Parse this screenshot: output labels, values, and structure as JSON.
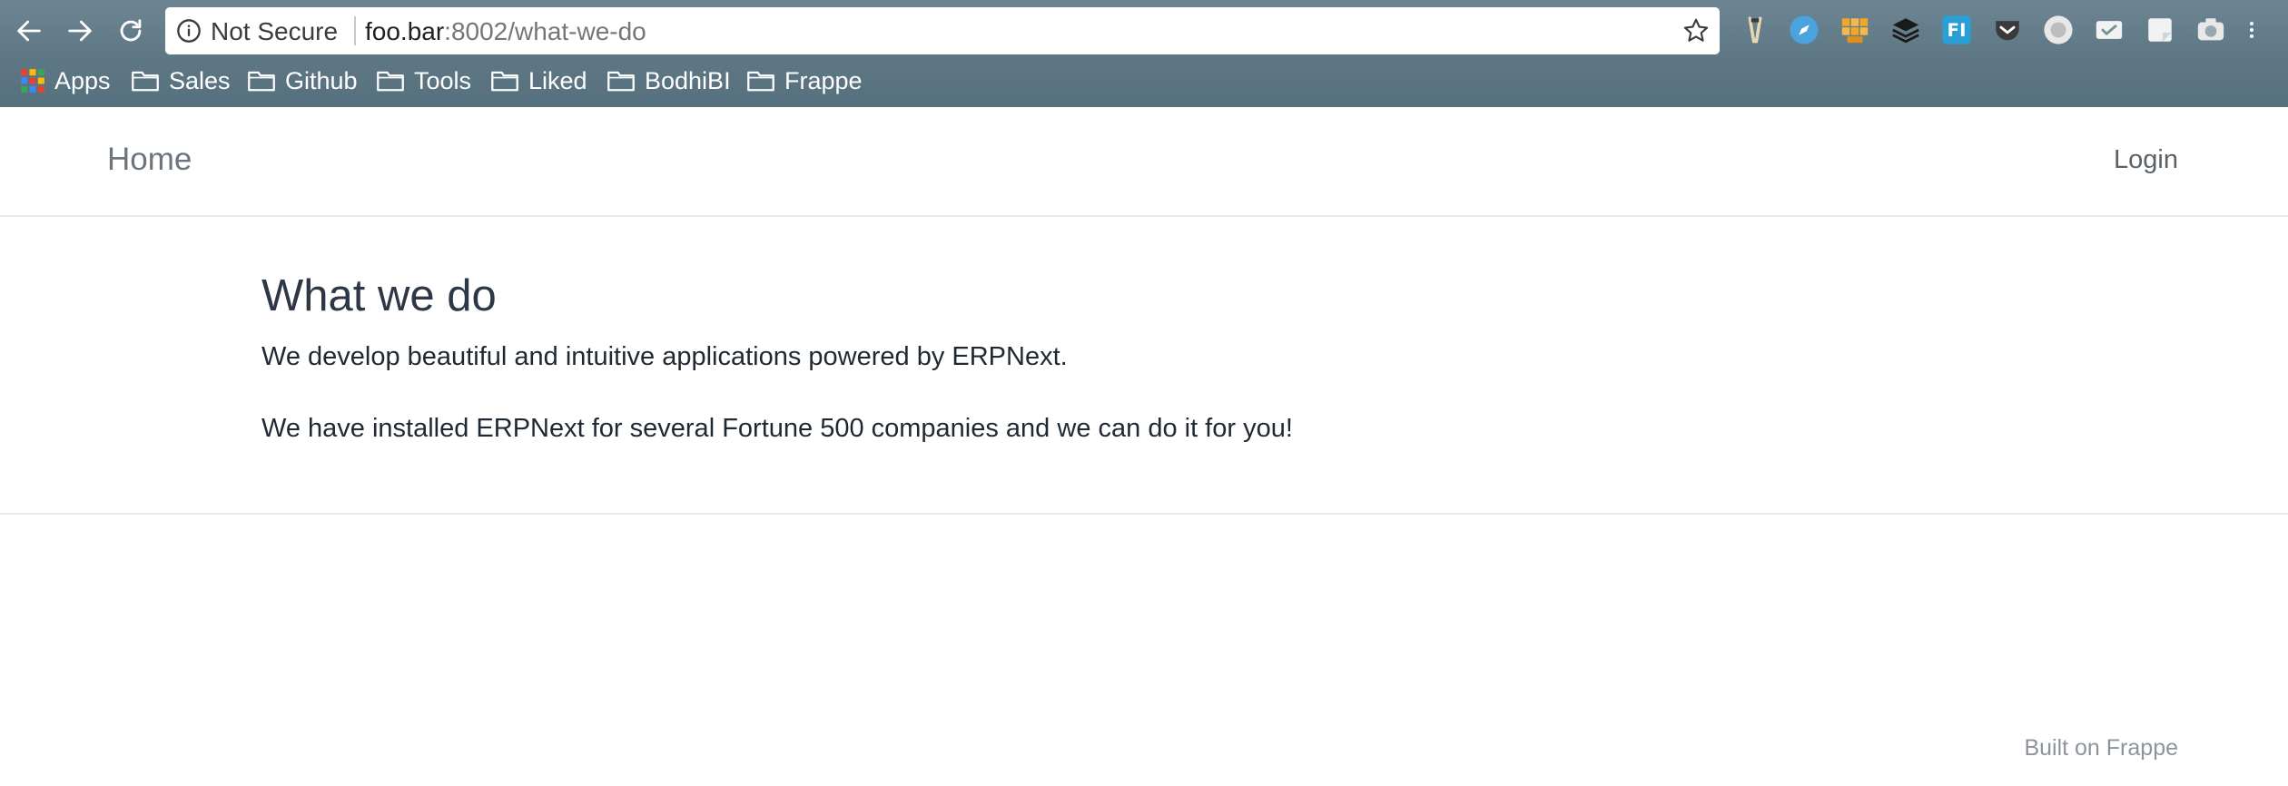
{
  "browser": {
    "security_label": "Not Secure",
    "url_host": "foo.bar",
    "url_rest": ":8002/what-we-do",
    "extensions": [
      "tweezers-icon",
      "safari-compass-icon",
      "aws-boxes-icon",
      "layers-icon",
      "fi-icon",
      "pocket-icon",
      "circle-record-icon",
      "mail-check-icon",
      "note-icon",
      "camera-icon"
    ],
    "bookmarks": [
      {
        "label": "Apps",
        "icon": "apps-grid-icon"
      },
      {
        "label": "Sales",
        "icon": "folder-icon"
      },
      {
        "label": "Github",
        "icon": "folder-icon"
      },
      {
        "label": "Tools",
        "icon": "folder-icon"
      },
      {
        "label": "Liked",
        "icon": "folder-icon"
      },
      {
        "label": "BodhiBI",
        "icon": "folder-icon"
      },
      {
        "label": "Frappe",
        "icon": "folder-icon"
      }
    ]
  },
  "navbar": {
    "brand": "Home",
    "login": "Login"
  },
  "main": {
    "title": "What we do",
    "paragraphs": [
      "We develop beautiful and intuitive applications powered by ERPNext.",
      "We have installed ERPNext for several Fortune 500 companies and we can do it for you!"
    ]
  },
  "footer": {
    "text": "Built on Frappe"
  }
}
